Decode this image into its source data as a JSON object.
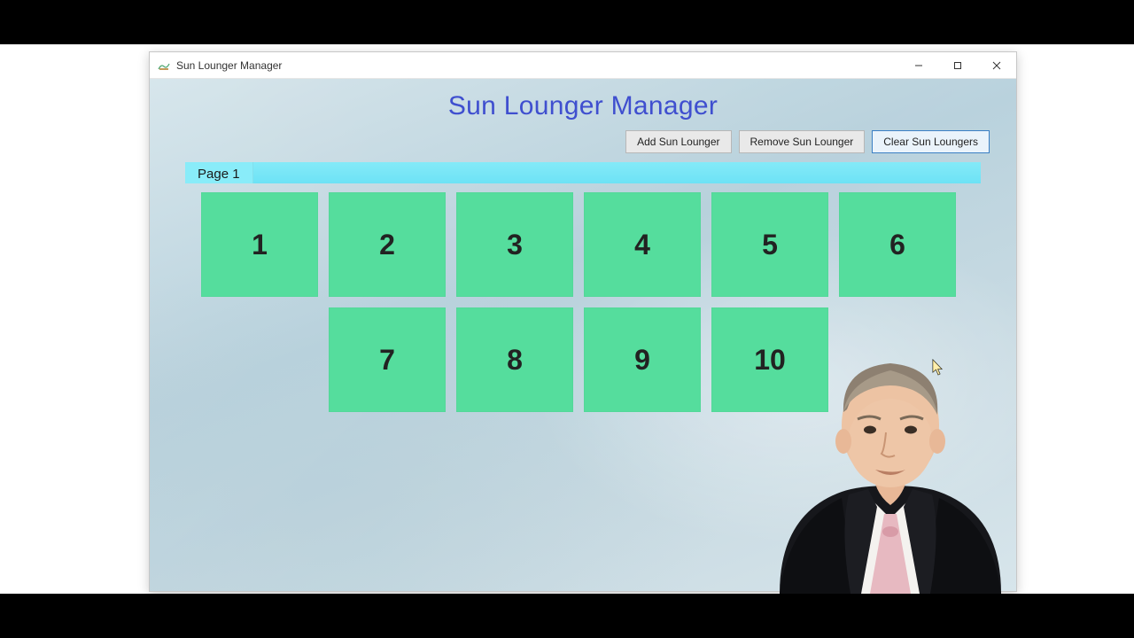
{
  "window": {
    "title": "Sun Lounger Manager"
  },
  "heading": "Sun Lounger Manager",
  "toolbar": {
    "add": "Add Sun Lounger",
    "remove": "Remove Sun Lounger",
    "clear": "Clear Sun Loungers"
  },
  "tabs": {
    "active": "Page 1"
  },
  "loungers": {
    "row1": [
      "1",
      "2",
      "3",
      "4",
      "5",
      "6"
    ],
    "row2": [
      "7",
      "8",
      "9",
      "10"
    ]
  },
  "colors": {
    "tile": "#55dd9d",
    "tabStrip": "#7be9f7",
    "heading": "#3f4fcf"
  }
}
